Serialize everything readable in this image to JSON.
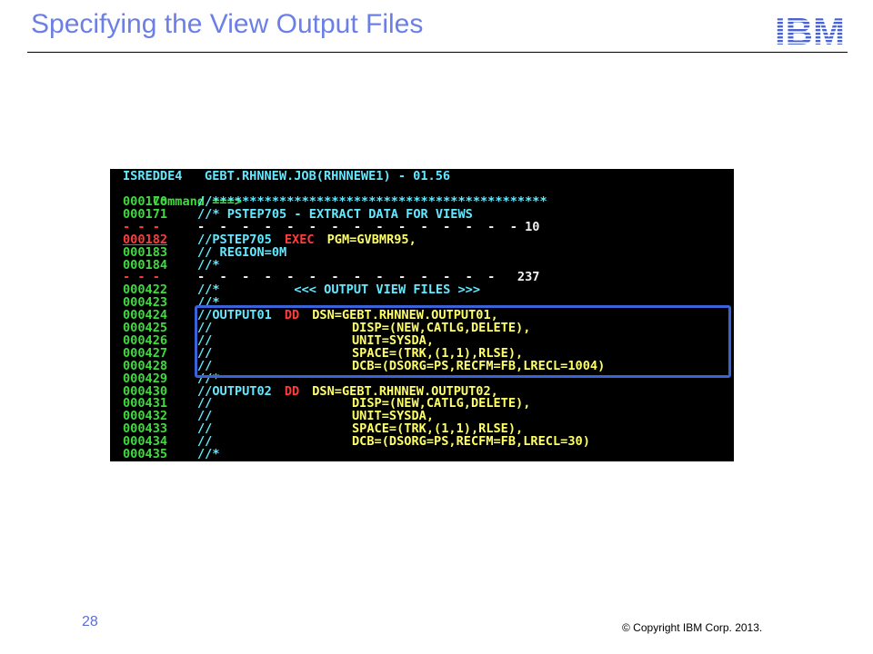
{
  "slide": {
    "title": "Specifying the View Output Files",
    "page_number": "28",
    "copyright": "© Copyright IBM Corp. 2013.",
    "logo_text": "IBM"
  },
  "colors": {
    "title": "#6b7fe6",
    "terminal_bg": "#000000",
    "highlight_border": "#3a63d8"
  },
  "terminal": {
    "header": "ISREDDE4   GEBT.RHNNEW.JOB(RHNNEWE1) - 01.56",
    "command": "Command ===>",
    "lines": [
      {
        "num": "000170",
        "text": "//*********************************************"
      },
      {
        "num": "000171",
        "text": "//* PSTEP705 - EXTRACT DATA FOR VIEWS"
      },
      {
        "num": "- - - ",
        "text": "-  -  -  -  -  -  -  -  -  -  -  -  -  -  - 10"
      },
      {
        "num": "000182",
        "text": "//PSTEP705",
        "kw": "EXEC",
        "rest": "PGM=GVBMR95,"
      },
      {
        "num": "000183",
        "text": "// REGION=0M"
      },
      {
        "num": "000184",
        "text": "//*"
      },
      {
        "num": "- - - ",
        "text": "-  -  -  -  -  -  -  -  -  -  -  -  -  -   237"
      },
      {
        "num": "000422",
        "text": "//*          <<< OUTPUT VIEW FILES >>>"
      },
      {
        "num": "000423",
        "text": "//*"
      },
      {
        "num": "000424",
        "text": "//OUTPUT01",
        "kw": "DD",
        "rest": "DSN=GEBT.RHNNEW.OUTPUT01,"
      },
      {
        "num": "000425",
        "text": "//",
        "rest": "DISP=(NEW,CATLG,DELETE),"
      },
      {
        "num": "000426",
        "text": "//",
        "rest": "UNIT=SYSDA,"
      },
      {
        "num": "000427",
        "text": "//",
        "rest": "SPACE=(TRK,(1,1),RLSE),"
      },
      {
        "num": "000428",
        "text": "//",
        "rest": "DCB=(DSORG=PS,RECFM=FB,LRECL=1004)"
      },
      {
        "num": "000429",
        "text": "//*"
      },
      {
        "num": "000430",
        "text": "//OUTPUT02",
        "kw": "DD",
        "rest": "DSN=GEBT.RHNNEW.OUTPUT02,"
      },
      {
        "num": "000431",
        "text": "//",
        "rest": "DISP=(NEW,CATLG,DELETE),"
      },
      {
        "num": "000432",
        "text": "//",
        "rest": "UNIT=SYSDA,"
      },
      {
        "num": "000433",
        "text": "//",
        "rest": "SPACE=(TRK,(1,1),RLSE),"
      },
      {
        "num": "000434",
        "text": "//",
        "rest": "DCB=(DSORG=PS,RECFM=FB,LRECL=30)"
      },
      {
        "num": "000435",
        "text": "//*"
      }
    ]
  }
}
